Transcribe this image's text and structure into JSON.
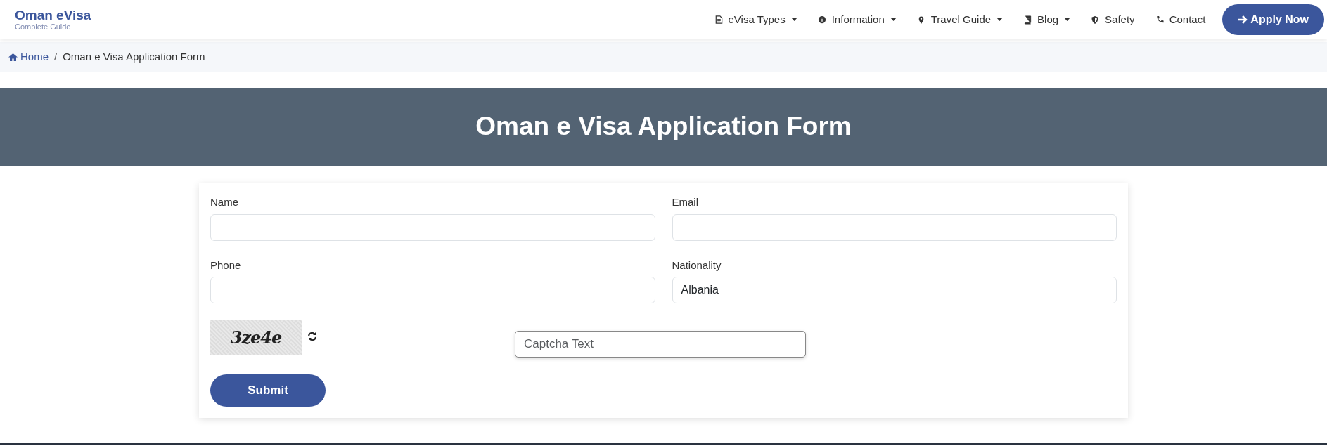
{
  "brand": {
    "title": "Oman eVisa",
    "subtitle": "Complete Guide"
  },
  "nav": [
    {
      "label": "eVisa Types",
      "dropdown": true
    },
    {
      "label": "Information",
      "dropdown": true
    },
    {
      "label": "Travel Guide",
      "dropdown": true
    },
    {
      "label": "Blog",
      "dropdown": true
    },
    {
      "label": "Safety",
      "dropdown": false
    },
    {
      "label": "Contact",
      "dropdown": false
    }
  ],
  "apply_button": {
    "label": "Apply Now"
  },
  "breadcrumb": [
    {
      "label": "Home",
      "link": true
    },
    {
      "separator": "/",
      "label": "Oman e Visa Application Form",
      "link": false
    }
  ],
  "hero": {
    "title": "Oman e Visa Application Form"
  },
  "form": {
    "fields": [
      {
        "label": "Name"
      },
      {
        "label": "Email"
      },
      {
        "label": "Phone"
      },
      {
        "label": "Nationality",
        "value": "Albania"
      }
    ],
    "captcha": {
      "text": "3ze4e",
      "placeholder": "Captcha Text"
    },
    "submit": "Submit"
  }
}
